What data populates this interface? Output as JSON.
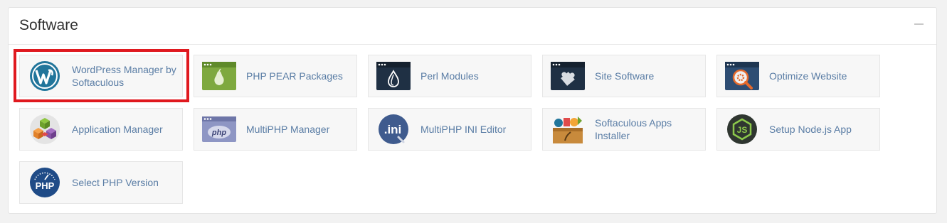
{
  "section": {
    "title": "Software"
  },
  "items": [
    {
      "label": "WordPress Manager by Softaculous",
      "icon": "wordpress-icon"
    },
    {
      "label": "PHP PEAR Packages",
      "icon": "pear-icon"
    },
    {
      "label": "Perl Modules",
      "icon": "perl-onion-icon"
    },
    {
      "label": "Site Software",
      "icon": "puzzle-icon"
    },
    {
      "label": "Optimize Website",
      "icon": "magnifier-gear-icon"
    },
    {
      "label": "Application Manager",
      "icon": "cubes-icon"
    },
    {
      "label": "MultiPHP Manager",
      "icon": "php-window-icon"
    },
    {
      "label": "MultiPHP INI Editor",
      "icon": "ini-file-icon"
    },
    {
      "label": "Softaculous Apps Installer",
      "icon": "softaculous-box-icon"
    },
    {
      "label": "Setup Node.js App",
      "icon": "nodejs-icon"
    },
    {
      "label": "Select PHP Version",
      "icon": "php-gauge-icon"
    }
  ],
  "icon_text": {
    "php": "php",
    "ini": ".ini",
    "js": "JS",
    "php_upper": "PHP"
  },
  "colors": {
    "link": "#5a7da5",
    "highlight": "#e0191f",
    "wordpress": "#21759b",
    "pear_green": "#7ea93f",
    "dark_window": "#1f3044",
    "node_green": "#8cc84b"
  }
}
